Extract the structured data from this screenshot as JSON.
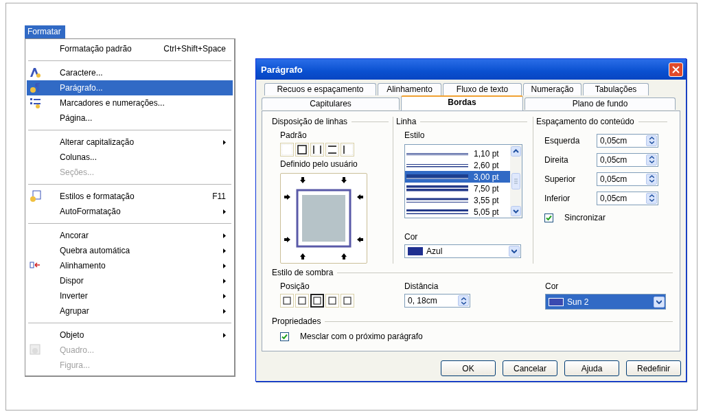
{
  "menu": {
    "title": "Formatar",
    "items": [
      {
        "kind": "item",
        "label": "Formatação padrão",
        "shortcut": "Ctrl+Shift+Space",
        "submenu": false,
        "disabled": false,
        "selected": false
      },
      {
        "kind": "separator"
      },
      {
        "kind": "item",
        "label": "Caractere...",
        "submenu": false,
        "disabled": false,
        "selected": false
      },
      {
        "kind": "item",
        "label": "Parágrafo...",
        "submenu": false,
        "disabled": false,
        "selected": true
      },
      {
        "kind": "item",
        "label": "Marcadores e numerações...",
        "submenu": false,
        "disabled": false,
        "selected": false
      },
      {
        "kind": "item",
        "label": "Página...",
        "submenu": false,
        "disabled": false,
        "selected": false
      },
      {
        "kind": "separator"
      },
      {
        "kind": "item",
        "label": "Alterar capitalização",
        "submenu": true,
        "disabled": false,
        "selected": false
      },
      {
        "kind": "item",
        "label": "Colunas...",
        "submenu": false,
        "disabled": false,
        "selected": false
      },
      {
        "kind": "item",
        "label": "Seções...",
        "submenu": false,
        "disabled": true,
        "selected": false
      },
      {
        "kind": "separator"
      },
      {
        "kind": "item",
        "label": "Estilos e formatação",
        "shortcut": "F11",
        "submenu": false,
        "disabled": false,
        "selected": false
      },
      {
        "kind": "item",
        "label": "AutoFormatação",
        "submenu": true,
        "disabled": false,
        "selected": false
      },
      {
        "kind": "separator"
      },
      {
        "kind": "item",
        "label": "Ancorar",
        "submenu": true,
        "disabled": false,
        "selected": false
      },
      {
        "kind": "item",
        "label": "Quebra automática",
        "submenu": true,
        "disabled": false,
        "selected": false
      },
      {
        "kind": "item",
        "label": "Alinhamento",
        "submenu": true,
        "disabled": false,
        "selected": false
      },
      {
        "kind": "item",
        "label": "Dispor",
        "submenu": true,
        "disabled": false,
        "selected": false
      },
      {
        "kind": "item",
        "label": "Inverter",
        "submenu": true,
        "disabled": false,
        "selected": false
      },
      {
        "kind": "item",
        "label": "Agrupar",
        "submenu": true,
        "disabled": false,
        "selected": false
      },
      {
        "kind": "separator"
      },
      {
        "kind": "item",
        "label": "Objeto",
        "submenu": true,
        "disabled": false,
        "selected": false
      },
      {
        "kind": "item",
        "label": "Quadro...",
        "submenu": false,
        "disabled": true,
        "selected": false
      },
      {
        "kind": "item",
        "label": "Figura...",
        "submenu": false,
        "disabled": true,
        "selected": false
      }
    ]
  },
  "dialog": {
    "title": "Parágrafo",
    "tab_rows": [
      [
        {
          "label": "Recuos e espaçamento",
          "selected": false
        },
        {
          "label": "Alinhamento",
          "selected": false
        },
        {
          "label": "Fluxo de texto",
          "selected": false
        },
        {
          "label": "Numeração",
          "selected": false
        },
        {
          "label": "Tabulações",
          "selected": false
        }
      ],
      [
        {
          "label": "Capitulares",
          "selected": false
        },
        {
          "label": "Bordas",
          "selected": true
        },
        {
          "label": "Plano de fundo",
          "selected": false
        }
      ]
    ],
    "line_arrangement": {
      "title": "Disposição de linhas",
      "default_label": "Padrão",
      "presets": [
        {
          "selected": false
        },
        {
          "selected": false
        },
        {
          "selected": false
        },
        {
          "selected": false
        },
        {
          "selected": false
        }
      ],
      "user_label": "Definido pelo usuário"
    },
    "line": {
      "title": "Linha",
      "style_label": "Estilo",
      "styles": [
        {
          "label": "1,10 pt",
          "selected": false
        },
        {
          "label": "2,60 pt",
          "selected": false
        },
        {
          "label": "3,00 pt",
          "selected": true
        },
        {
          "label": "7,50 pt",
          "selected": false
        },
        {
          "label": "3,55 pt",
          "selected": false
        },
        {
          "label": "5,05 pt",
          "selected": false
        }
      ],
      "color_label": "Cor",
      "color_value": "Azul"
    },
    "spacing": {
      "title": "Espaçamento do conteúdo",
      "fields": [
        {
          "label": "Esquerda",
          "value": "0,05cm"
        },
        {
          "label": "Direita",
          "value": "0,05cm"
        },
        {
          "label": "Superior",
          "value": "0,05cm"
        },
        {
          "label": "Inferior",
          "value": "0,05cm"
        }
      ],
      "sync": {
        "label": "Sincronizar",
        "checked": true
      }
    },
    "shadow": {
      "title": "Estilo de sombra",
      "position_label": "Posição",
      "positions": [
        {
          "selected": false
        },
        {
          "selected": false
        },
        {
          "selected": true
        },
        {
          "selected": false
        },
        {
          "selected": false
        }
      ],
      "distance_label": "Distância",
      "distance": "0, 18cm",
      "color_label": "Cor",
      "color_value": "Sun 2"
    },
    "properties": {
      "title": "Propriedades",
      "merge": {
        "label": "Mesclar com o próximo parágrafo",
        "checked": true
      }
    },
    "buttons": [
      "OK",
      "Cancelar",
      "Ajuda",
      "Redefinir"
    ]
  }
}
